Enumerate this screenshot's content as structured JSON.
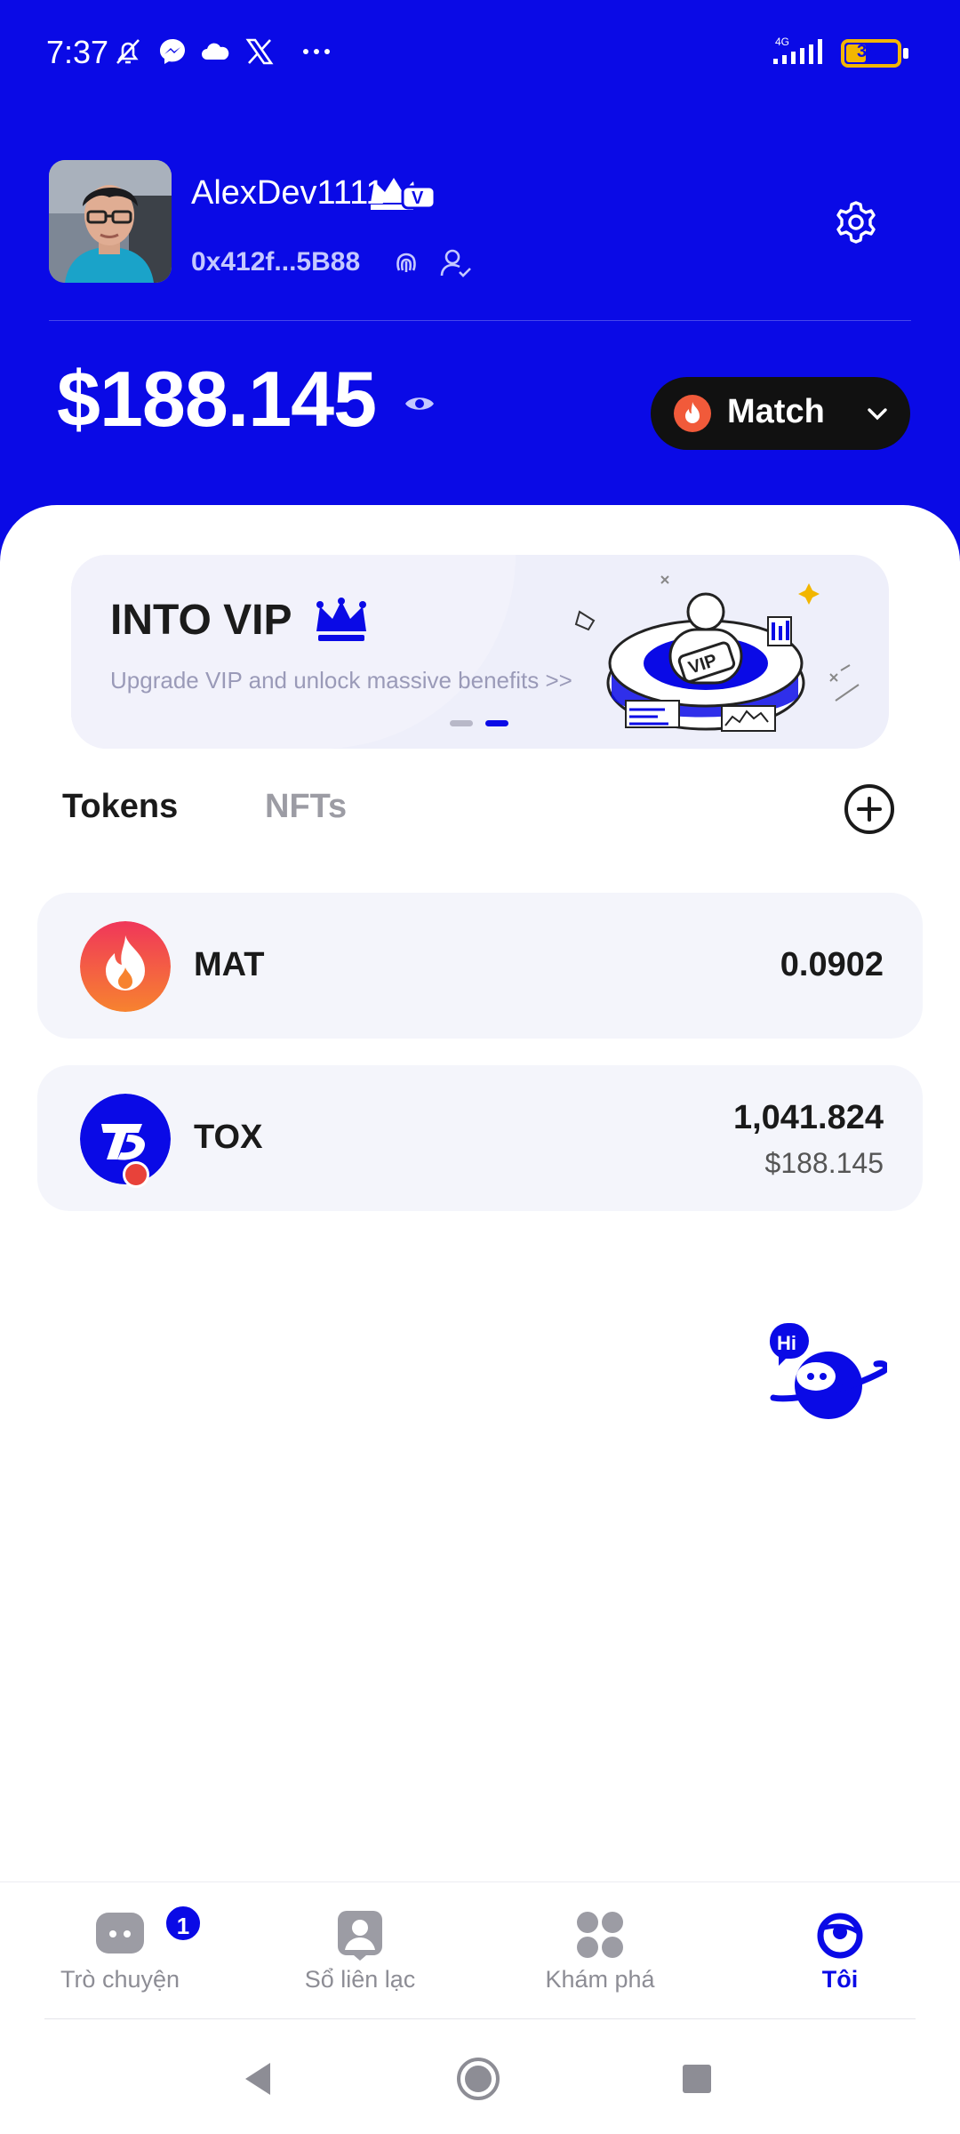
{
  "status_bar": {
    "time": "7:37",
    "network": "4G",
    "battery": "34",
    "icons": [
      "bell-off-icon",
      "messenger-icon",
      "cloud-icon",
      "x-logo-icon",
      "more-dots-icon"
    ]
  },
  "profile": {
    "username": "AlexDev1111",
    "address": "0x412f...5B88",
    "badge": "V"
  },
  "wallet": {
    "balance": "$188.145",
    "network_label": "Match"
  },
  "banner": {
    "title": "INTO VIP",
    "subtitle": "Upgrade VIP and unlock massive benefits >>",
    "illustration_text": "VIP"
  },
  "tabs": [
    {
      "label": "Tokens",
      "active": true
    },
    {
      "label": "NFTs",
      "active": false
    }
  ],
  "tokens": [
    {
      "symbol": "MAT",
      "amount": "0.0902",
      "value": ""
    },
    {
      "symbol": "TOX",
      "amount": "1,041.824",
      "value": "$188.145"
    }
  ],
  "assistant": {
    "greeting": "Hi"
  },
  "bottom_nav": [
    {
      "label": "Trò chuyện",
      "icon": "chat-icon",
      "badge": "1",
      "active": false
    },
    {
      "label": "Sổ liên lạc",
      "icon": "contacts-icon",
      "active": false
    },
    {
      "label": "Khám phá",
      "icon": "explore-icon",
      "active": false
    },
    {
      "label": "Tôi",
      "icon": "profile-planet-icon",
      "active": true
    }
  ],
  "colors": {
    "brand_blue": "#0a0ae6",
    "network_button": "#111111",
    "card_bg": "#f4f5fb",
    "flame_orange": "#f26a3a",
    "battery_yellow": "#f2b600"
  }
}
